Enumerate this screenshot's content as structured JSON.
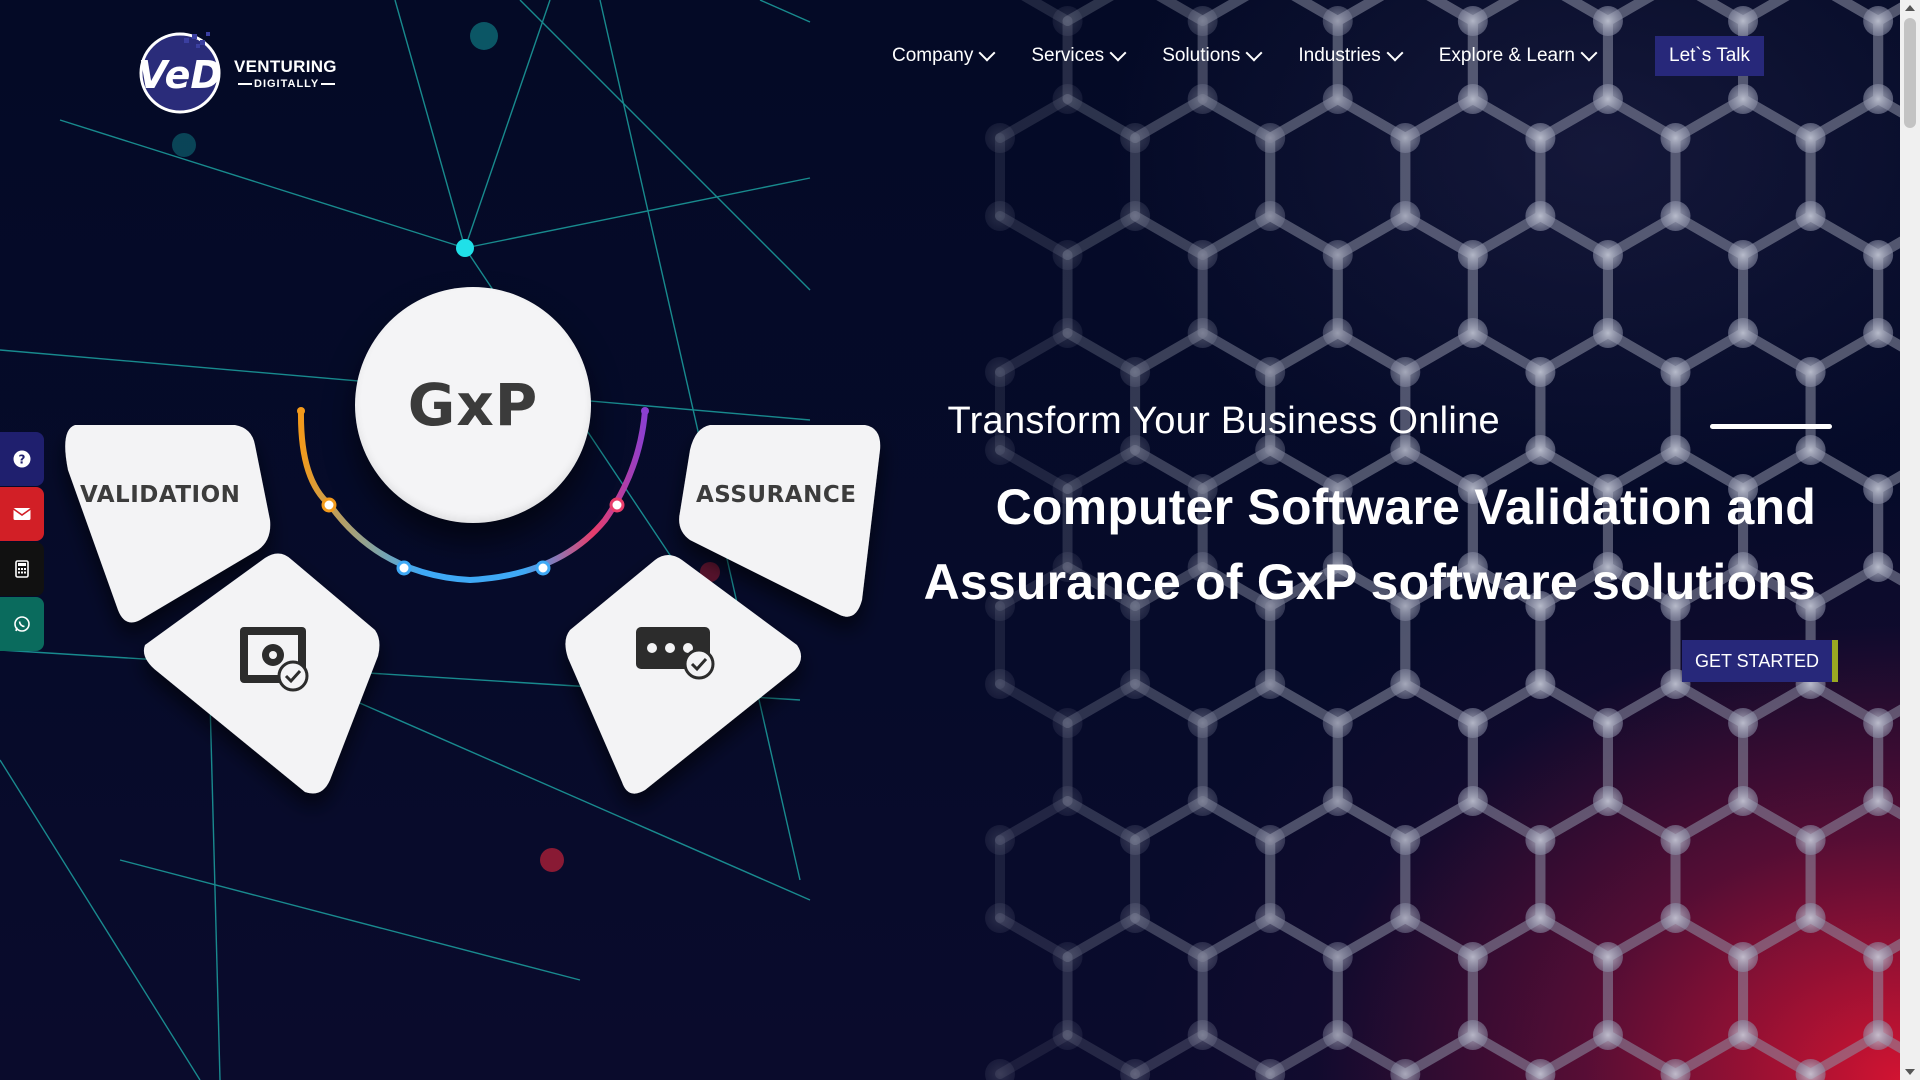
{
  "brand": {
    "logo_mark": "VeD",
    "name_line1": "VENTURING",
    "name_line2": "DIGITALLY"
  },
  "nav": {
    "items": [
      {
        "label": "Company",
        "name": "nav-company"
      },
      {
        "label": "Services",
        "name": "nav-services"
      },
      {
        "label": "Solutions",
        "name": "nav-solutions"
      },
      {
        "label": "Industries",
        "name": "nav-industries"
      },
      {
        "label": "Explore & Learn",
        "name": "nav-explore-learn"
      }
    ],
    "cta_label": "Let`s Talk"
  },
  "side_bar": {
    "items": [
      {
        "icon": "question-circle-icon",
        "color": "#1f1f6e"
      },
      {
        "icon": "envelope-icon",
        "color": "#d21f26"
      },
      {
        "icon": "calculator-icon",
        "color": "#111111"
      },
      {
        "icon": "whatsapp-icon",
        "color": "#0a6b5d"
      }
    ]
  },
  "graphic": {
    "center_label": "GxP",
    "left_label": "VALIDATION",
    "right_label": "ASSURANCE",
    "left_icon": "gear-certificate-icon",
    "right_icon": "password-check-icon"
  },
  "hero": {
    "tagline": "Transform Your Business Online",
    "headline_line1": "Computer Software Validation and",
    "headline_line2": "Assurance of GxP software solutions",
    "cta_label": "GET STARTED"
  },
  "colors": {
    "background": "#050a24",
    "accent": "#27287a",
    "cta_edge": "#9aa822",
    "glow_red": "#dc1432"
  }
}
